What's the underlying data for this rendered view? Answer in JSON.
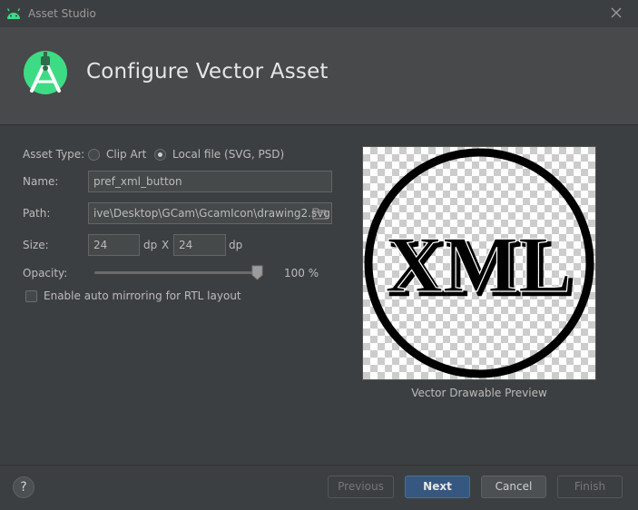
{
  "window": {
    "title": "Asset Studio"
  },
  "header": {
    "title": "Configure Vector Asset"
  },
  "form": {
    "asset_type_label": "Asset Type:",
    "asset_type_options": [
      {
        "label": "Clip Art",
        "selected": false
      },
      {
        "label": "Local file (SVG, PSD)",
        "selected": true
      }
    ],
    "name_label": "Name:",
    "name_value": "pref_xml_button",
    "path_label": "Path:",
    "path_value": "ive\\Desktop\\GCam\\GcamIcon\\drawing2.svg",
    "size_label": "Size:",
    "width_value": "24",
    "width_unit": "dp",
    "size_separator": "X",
    "height_value": "24",
    "height_unit": "dp",
    "opacity_label": "Opacity:",
    "opacity_percent": 100,
    "opacity_display": "100 %",
    "rtl_label": "Enable auto mirroring for RTL layout",
    "rtl_checked": false
  },
  "preview": {
    "image_text": "XML",
    "caption": "Vector Drawable Preview"
  },
  "footer": {
    "help_label": "?",
    "previous_label": "Previous",
    "next_label": "Next",
    "cancel_label": "Cancel",
    "finish_label": "Finish"
  },
  "colors": {
    "accent": "#365880",
    "android_green": "#3ddc84",
    "background": "#3c3f41"
  }
}
